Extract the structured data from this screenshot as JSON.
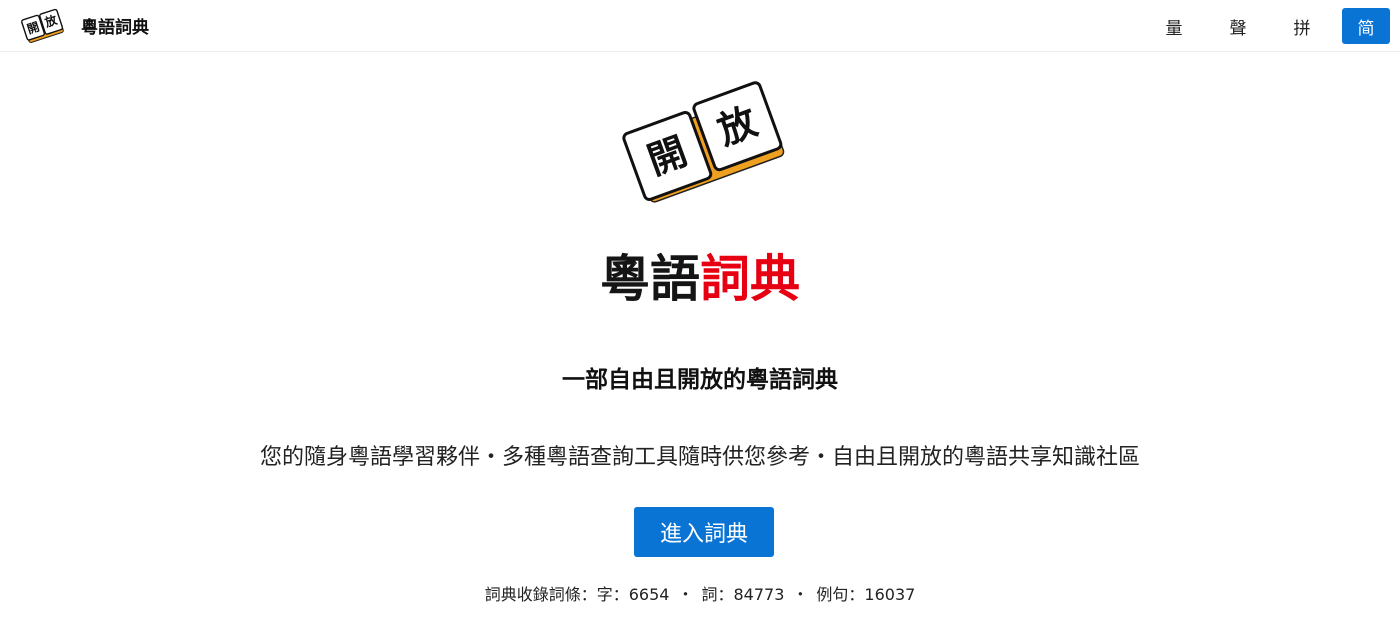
{
  "nav": {
    "logo_chars": [
      "開",
      "放"
    ],
    "title": "粵語詞典",
    "buttons": [
      {
        "label": "量"
      },
      {
        "label": "聲"
      },
      {
        "label": "拼"
      },
      {
        "label": "简",
        "active": true
      }
    ]
  },
  "hero": {
    "logo_chars": [
      "開",
      "放"
    ],
    "title_part1": "粵語",
    "title_part2": "詞典",
    "subtitle": "一部自由且開放的粵語詞典",
    "description": "您的隨身粵語學習夥伴・多種粵語查詢工具隨時供您參考・自由且開放的粵語共享知識社區",
    "enter_label": "進入詞典"
  },
  "stats": {
    "prefix": "詞典收錄詞條：",
    "char_label": "字：",
    "char_count": "6654",
    "word_label": "詞：",
    "word_count": "84773",
    "example_label": "例句：",
    "example_count": "16037",
    "separator": "・"
  },
  "colors": {
    "accent": "#0a74d4",
    "title_red": "#e60012",
    "logo_orange": "#f0a020"
  }
}
